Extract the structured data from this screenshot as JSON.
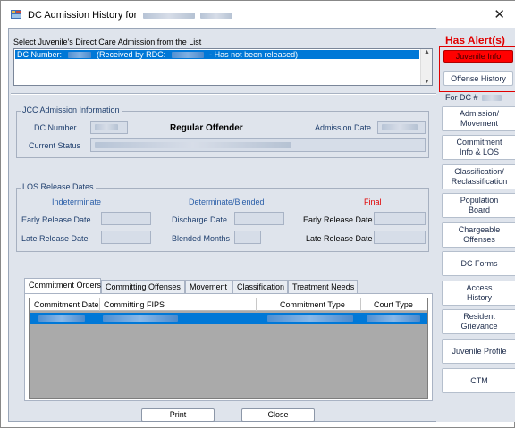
{
  "window": {
    "title": "DC Admission History for"
  },
  "admissions": {
    "prompt": "Select Juvenile's Direct Care Admission from the List",
    "rows": [
      {
        "dc_prefix": "DC Number:",
        "received_prefix": "(Received by RDC:",
        "status": "- Has not been released)"
      }
    ]
  },
  "jcc": {
    "group_title": "JCC Admission Information",
    "dc_number_label": "DC Number",
    "offender_type": "Regular Offender",
    "admission_date_label": "Admission Date",
    "current_status_label": "Current Status"
  },
  "los": {
    "group_title": "LOS Release Dates",
    "indeterminate_label": "Indeterminate",
    "determinate_label": "Determinate/Blended",
    "final_label": "Final",
    "early_release_label": "Early Release Date",
    "late_release_label": "Late Release Date",
    "discharge_label": "Discharge Date",
    "blended_months_label": "Blended Months",
    "final_early_release_label": "Early Release Date",
    "final_late_release_label": "Late Release Date"
  },
  "tabs": [
    {
      "label": "Commitment Orders"
    },
    {
      "label": "Committing Offenses"
    },
    {
      "label": "Movement"
    },
    {
      "label": "Classification"
    },
    {
      "label": "Treatment Needs"
    }
  ],
  "grid": {
    "columns": [
      "Commitment Date",
      "Committing FIPS",
      "Commitment Type",
      "Court Type"
    ]
  },
  "sidebar": {
    "alert_text": "Has Alert(s)",
    "juvenile_info": "Juvenile Info",
    "offense_history": "Offense History",
    "for_dc": "For DC #",
    "buttons": [
      "Admission/\nMovement",
      "Commitment\nInfo & LOS",
      "Classification/\nReclassification",
      "Population\nBoard",
      "Chargeable\nOffenses",
      "DC Forms",
      "Access\nHistory",
      "Resident\nGrievance",
      "Juvenile Profile",
      "CTM"
    ]
  },
  "footer": {
    "print": "Print",
    "close": "Close"
  },
  "colors": {
    "alert": "#e00000",
    "selection": "#0078d7",
    "final_label": "#e00000",
    "label_blue": "#1f3f6e"
  }
}
